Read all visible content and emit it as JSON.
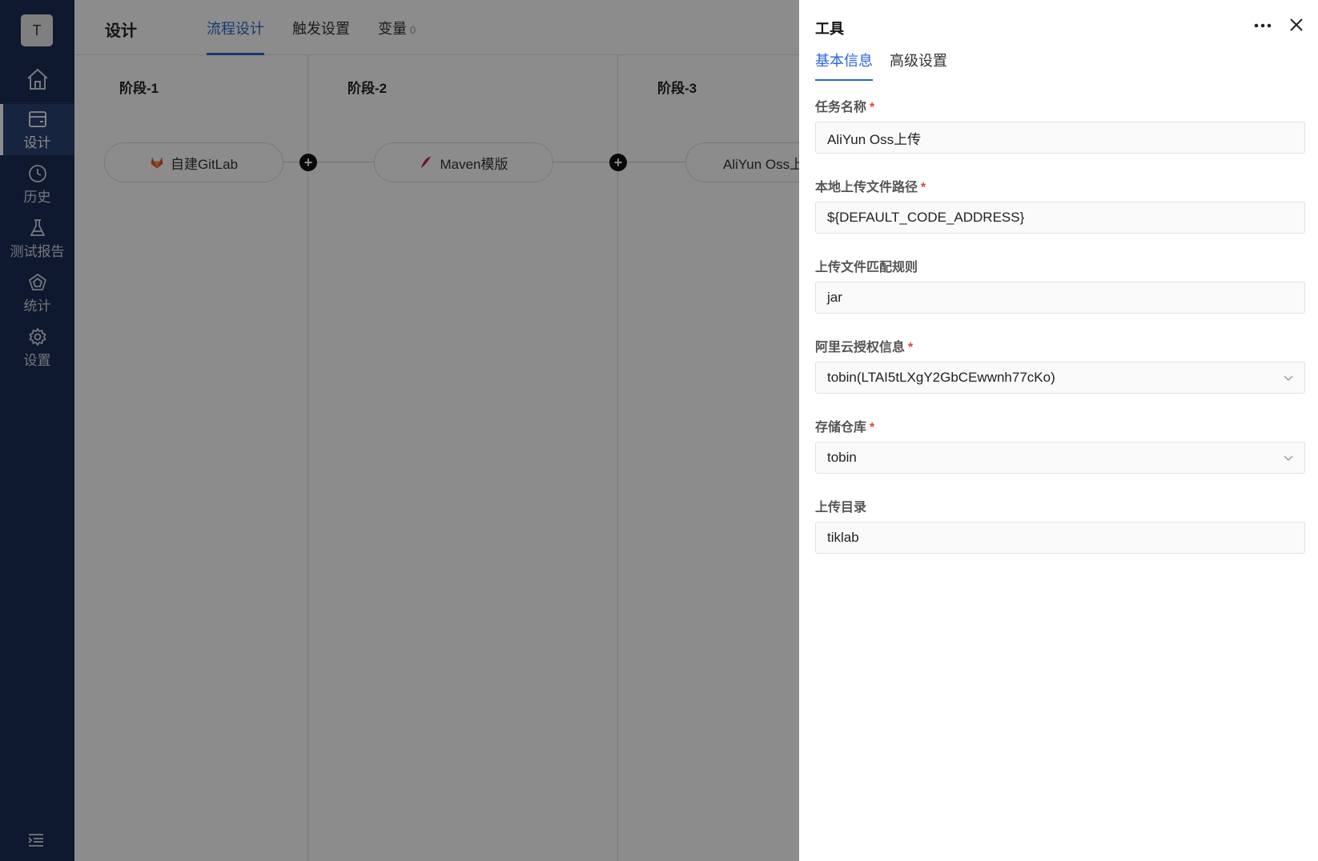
{
  "sidebar": {
    "avatar_letter": "T",
    "items": [
      {
        "label": "设计",
        "icon": "window-icon",
        "active": true
      },
      {
        "label": "历史",
        "icon": "clock-icon"
      },
      {
        "label": "测试报告",
        "icon": "flask-icon"
      },
      {
        "label": "统计",
        "icon": "pentagon-chart-icon"
      },
      {
        "label": "设置",
        "icon": "gear-icon"
      }
    ]
  },
  "header": {
    "title": "设计",
    "tabs": [
      {
        "label": "流程设计",
        "active": true
      },
      {
        "label": "触发设置"
      },
      {
        "label": "变量",
        "count": "0"
      }
    ]
  },
  "pipeline": {
    "stages": [
      {
        "title": "阶段-1",
        "task": "自建GitLab",
        "icon": "gitlab-icon"
      },
      {
        "title": "阶段-2",
        "task": "Maven模版",
        "icon": "maven-feather-icon"
      },
      {
        "title": "阶段-3",
        "task": "AliYun Oss上传",
        "icon": "aliyun-icon"
      }
    ]
  },
  "drawer": {
    "title": "工具",
    "tabs": [
      {
        "label": "基本信息",
        "active": true
      },
      {
        "label": "高级设置"
      }
    ],
    "fields": [
      {
        "label": "任务名称",
        "required": true,
        "value": "AliYun Oss上传"
      },
      {
        "label": "本地上传文件路径",
        "required": true,
        "value": "${DEFAULT_CODE_ADDRESS}"
      },
      {
        "label": "上传文件匹配规则",
        "required": false,
        "value": "jar"
      },
      {
        "label": "阿里云授权信息",
        "required": true,
        "value": "tobin(LTAI5tLXgY2GbCEwwnh77cKo)",
        "select": true
      },
      {
        "label": "存储仓库",
        "required": true,
        "value": "tobin",
        "select": true
      },
      {
        "label": "上传目录",
        "required": false,
        "value": "tiklab"
      }
    ],
    "required_mark": "*"
  },
  "colors": {
    "sidebar_bg": "#1a2d55",
    "accent": "#2966d6",
    "required": "#e0443a"
  }
}
